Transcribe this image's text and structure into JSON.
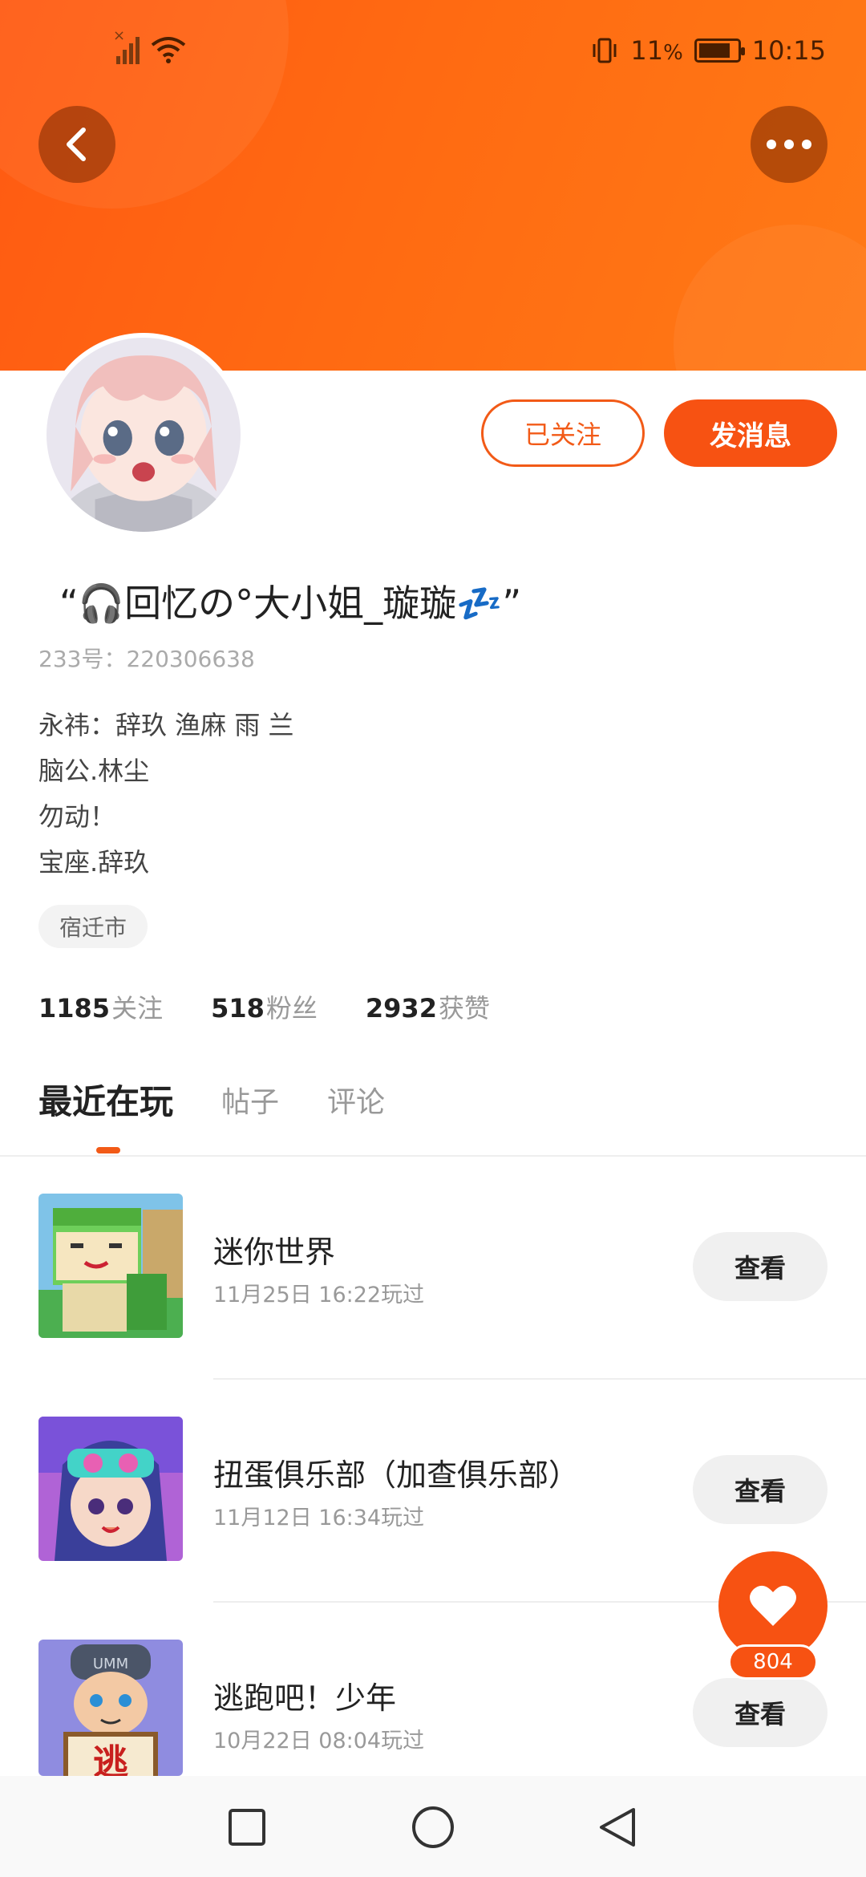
{
  "status_bar": {
    "battery_percent": "11",
    "battery_symbol": "%",
    "time": "10:15"
  },
  "header": {
    "back_icon": "chevron-left-icon",
    "more_icon": "more-horizontal-icon"
  },
  "profile": {
    "nickname": "“🎧回忆の°大小姐_璇璇💤”",
    "uid_label": "233号：",
    "uid": "220306638",
    "bio_lines": [
      "永祎：辞玖 渔麻 雨 兰",
      "脑公.林尘",
      "勿动！",
      "宝座.辞玖"
    ],
    "location": "宿迁市",
    "following_count": "1185",
    "following_label": "关注",
    "fans_count": "518",
    "fans_label": "粉丝",
    "likes_count": "2932",
    "likes_label": "获赞"
  },
  "actions": {
    "follow_label": "已关注",
    "message_label": "发消息"
  },
  "tabs": [
    {
      "label": "最近在玩",
      "active": true
    },
    {
      "label": "帖子",
      "active": false
    },
    {
      "label": "评论",
      "active": false
    }
  ],
  "games": [
    {
      "name": "迷你世界",
      "played": "11月25日 16:22玩过",
      "button": "查看"
    },
    {
      "name": "扭蛋俱乐部（加查俱乐部）",
      "played": "11月12日 16:34玩过",
      "button": "查看"
    },
    {
      "name": "逃跑吧！少年",
      "played": "10月22日 08:04玩过",
      "button": "查看"
    }
  ],
  "game3_icon_text": "逃",
  "game3_cap_text": "UMM",
  "like_fab": {
    "count": "804",
    "icon": "heart-icon"
  },
  "colors": {
    "accent": "#f75212",
    "banner": "#ff6a12"
  }
}
